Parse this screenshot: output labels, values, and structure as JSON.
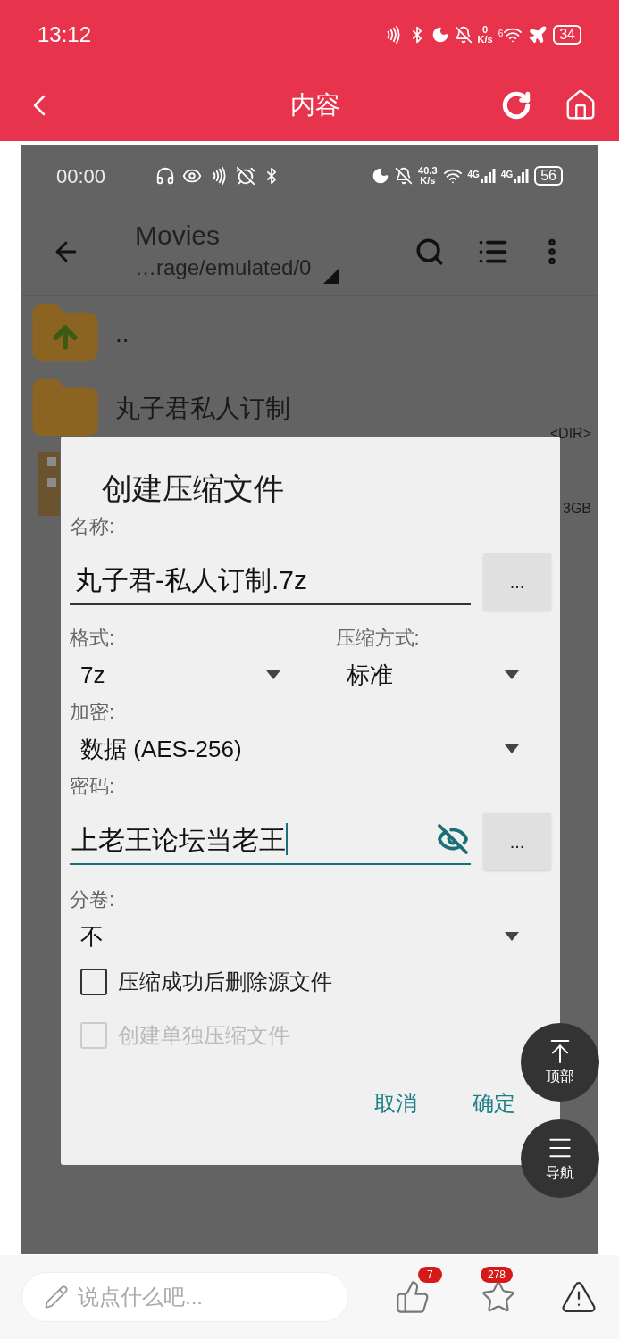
{
  "status_bar": {
    "time": "13:12",
    "net_speed": "0",
    "net_unit": "K/s",
    "wifi_label": "6",
    "battery": "34"
  },
  "header": {
    "title": "内容"
  },
  "screenshot": {
    "status_bar": {
      "time": "00:00",
      "net_speed": "40.3",
      "net_unit": "K/s",
      "signals": [
        "4G",
        "4G"
      ],
      "battery": "56"
    },
    "toolbar": {
      "title": "Movies",
      "path": "…rage/emulated/0"
    },
    "files": [
      {
        "kind": "up",
        "name": ".."
      },
      {
        "kind": "folder",
        "name": "丸子君私人订制",
        "size": "<DIR>"
      },
      {
        "kind": "archive",
        "size": "3GB"
      }
    ],
    "dialog": {
      "title": "创建压缩文件",
      "name_label": "名称:",
      "name_value": "丸子君-私人订制.7z",
      "browse_button": "...",
      "format_label": "格式:",
      "format_value": "7z",
      "method_label": "压缩方式:",
      "method_value": "标准",
      "encryption_label": "加密:",
      "encryption_value": "数据 (AES-256)",
      "password_label": "密码:",
      "password_value": "上老王论坛当老王",
      "password_focused": true,
      "password_button": "...",
      "split_label": "分卷:",
      "split_value": "不",
      "options": [
        {
          "label": "压缩成功后删除源文件",
          "checked": false,
          "disabled": false
        },
        {
          "label": "创建单独压缩文件",
          "checked": false,
          "disabled": true
        }
      ],
      "buttons": [
        "取消",
        "确定"
      ]
    }
  },
  "float_buttons": [
    {
      "kind": "top",
      "label": "顶部"
    },
    {
      "kind": "nav",
      "label": "导航"
    }
  ],
  "bottom_bar": {
    "comment_placeholder": "说点什么吧...",
    "likes": "7",
    "favorites": "278"
  }
}
